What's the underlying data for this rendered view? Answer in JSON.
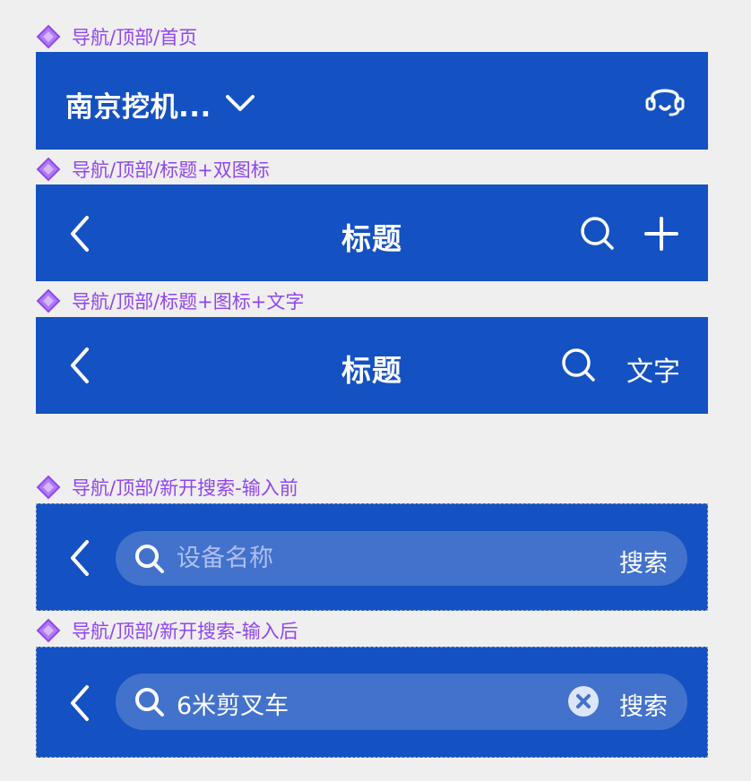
{
  "colors": {
    "background": "#efefef",
    "label_accent": "#8f46f0",
    "bar_blue": "#1451c2",
    "search_fill": "#4272cb",
    "placeholder": "#aebff0"
  },
  "sections": [
    {
      "label": "导航/顶部/首页",
      "title": "南京挖机...",
      "icons": [
        "chevron-down-icon",
        "headset-icon"
      ]
    },
    {
      "label": "导航/顶部/标题+双图标",
      "title": "标题",
      "icons": [
        "back-icon",
        "search-icon",
        "plus-icon"
      ]
    },
    {
      "label": "导航/顶部/标题+图标+文字",
      "title": "标题",
      "right_text": "文字",
      "icons": [
        "back-icon",
        "search-icon"
      ]
    },
    {
      "label": "导航/顶部/新开搜索-输入前",
      "search_placeholder": "设备名称",
      "search_action": "搜索",
      "icons": [
        "back-icon",
        "search-icon"
      ]
    },
    {
      "label": "导航/顶部/新开搜索-输入后",
      "search_value": "6米剪叉车",
      "search_action": "搜索",
      "icons": [
        "back-icon",
        "search-icon",
        "clear-icon"
      ]
    }
  ]
}
